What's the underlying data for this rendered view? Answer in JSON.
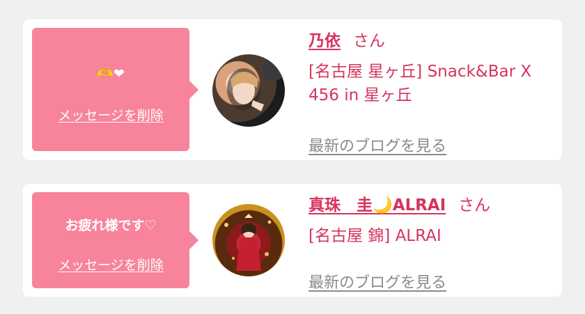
{
  "messages": [
    {
      "bubble_text": "🫶❤",
      "delete_label": "メッセージを削除",
      "name": "乃依",
      "honorific": "さん",
      "shop": "[名古屋 星ヶ丘] Snack&Bar X 456 in 星ヶ丘",
      "blog_label": "最新のブログを見る"
    },
    {
      "bubble_text": "お疲れ様です",
      "bubble_suffix": "♡",
      "delete_label": "メッセージを削除",
      "name_prefix": "真珠　圭",
      "name_emoji": "🌙",
      "name_suffix": "ALRAI",
      "honorific": "さん",
      "shop": "[名古屋 錦] ALRAI",
      "blog_label": "最新のブログを見る"
    }
  ],
  "colors": {
    "bubble": "#f7849b",
    "accent": "#d6335d",
    "muted_link": "#8a8a8a",
    "background": "#f0f0f0",
    "card": "#ffffff"
  },
  "icons": {
    "hands": "heart-hands-icon",
    "heart": "heart-icon",
    "moon": "moon-icon",
    "outline_heart": "outline-heart-icon"
  }
}
